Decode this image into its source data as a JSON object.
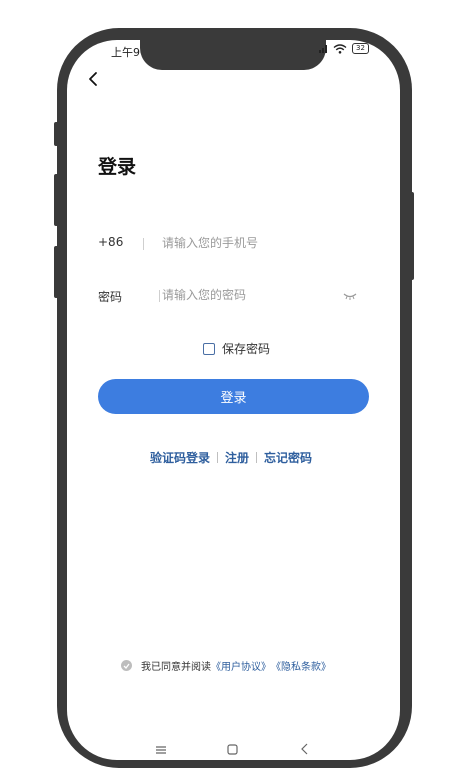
{
  "status_bar": {
    "time": "上午9",
    "battery": "32"
  },
  "page": {
    "title": "登录"
  },
  "phone_field": {
    "prefix": "+86",
    "placeholder": "请输入您的手机号"
  },
  "password_field": {
    "label": "密码",
    "placeholder": "请输入您的密码"
  },
  "remember": {
    "label": "保存密码"
  },
  "login_button": {
    "label": "登录"
  },
  "links": {
    "sms_login": "验证码登录",
    "register": "注册",
    "forgot": "忘记密码"
  },
  "agreement": {
    "text": "我已同意并阅读",
    "user_agreement": "《用户协议》",
    "privacy_policy": "《隐私条款》"
  },
  "colors": {
    "primary": "#3d7de0",
    "link": "#2f5f9e",
    "frame": "#3a3a3a"
  },
  "icons": [
    "back-arrow-icon",
    "wifi-icon",
    "signal-icon",
    "eye-closed-icon",
    "checkbox-icon",
    "check-circle-icon",
    "menu-icon",
    "home-icon",
    "back-icon"
  ]
}
